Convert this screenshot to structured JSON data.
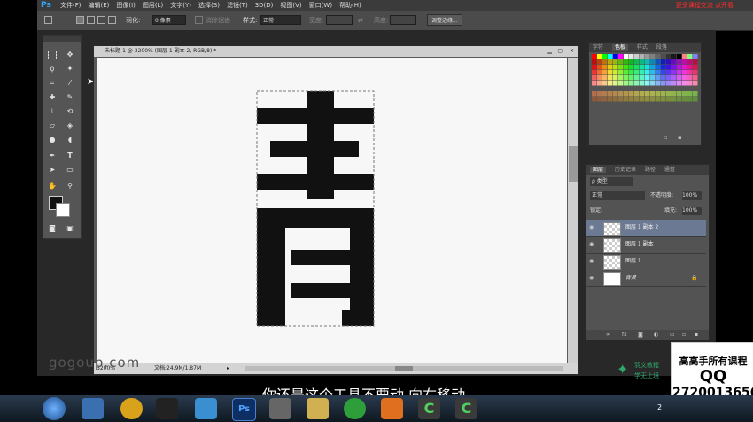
{
  "menubar": {
    "logo": "Ps",
    "items": [
      "文件(F)",
      "编辑(E)",
      "图像(I)",
      "图层(L)",
      "文字(Y)",
      "选择(S)",
      "滤镜(T)",
      "3D(D)",
      "视图(V)",
      "窗口(W)",
      "帮助(H)"
    ],
    "watermark": "更多课程交流 点开看"
  },
  "options": {
    "feather_label": "羽化:",
    "feather_value": "0 像素",
    "antialias_label": "消除锯齿",
    "style_label": "样式:",
    "style_value": "正常",
    "width_label": "宽度:",
    "height_label": "高度:",
    "refine_button": "调整边缘..."
  },
  "document": {
    "title": "未标题-1 @ 3200% (图层 1 副本 2, RGB/8) *",
    "zoom": "3200%",
    "doc_size": "文档:24.9M/1.87M"
  },
  "swatches": {
    "tabs": [
      "字符",
      "色板",
      "样式",
      "段落"
    ],
    "active_tab": "色板"
  },
  "layers": {
    "tabs": [
      "图层",
      "历史记录",
      "路径",
      "通道"
    ],
    "active_tab": "图层",
    "filter": "ρ 类型",
    "blend_mode": "正常",
    "opacity_label": "不透明度:",
    "opacity_value": "100%",
    "lock_label": "锁定:",
    "fill_label": "填充:",
    "fill_value": "100%",
    "rows": [
      {
        "name": "图层 1 副本 2"
      },
      {
        "name": "图层 1 副本"
      },
      {
        "name": "图层 1"
      },
      {
        "name": "背景"
      }
    ]
  },
  "overlay": {
    "subtitle": "你还是这个工具不要动 向右移动",
    "watermark_left": "gogoup.com"
  },
  "ad": {
    "line1": "高高手所有课程",
    "line2": "QQ",
    "line3": "2720013656"
  },
  "brand": {
    "line1": "羽文教程",
    "line2": "学无止境"
  },
  "taskbar": {
    "clock": "2"
  }
}
